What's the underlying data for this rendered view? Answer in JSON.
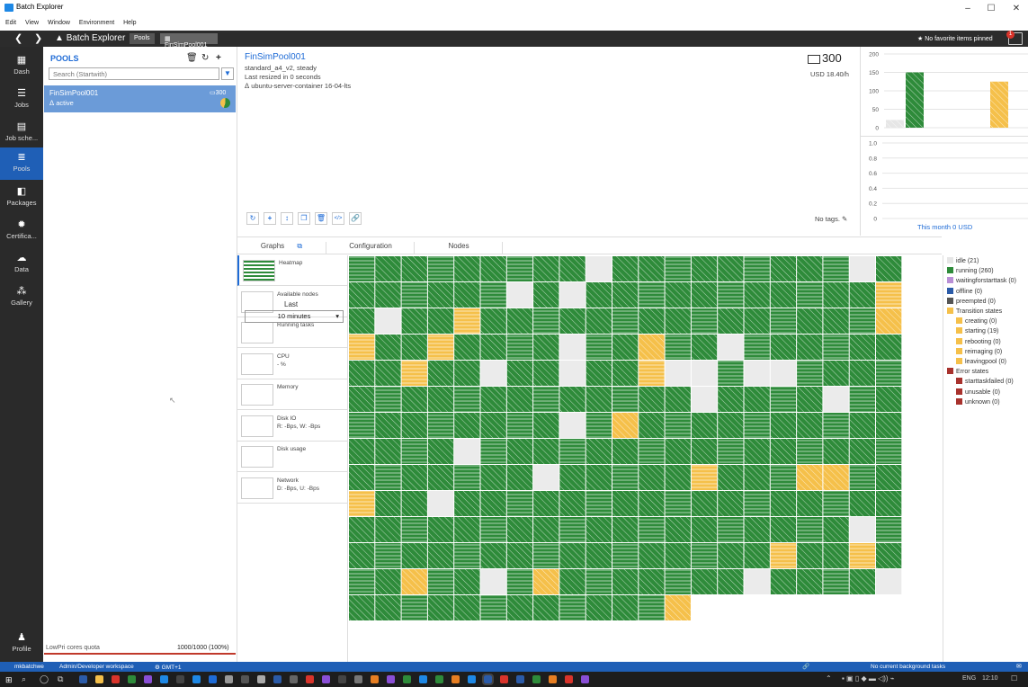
{
  "window": {
    "title": "Batch Explorer",
    "min": "–",
    "max": "☐",
    "close": "✕"
  },
  "menu": [
    "Edit",
    "View",
    "Window",
    "Environment",
    "Help"
  ],
  "nav": {
    "brand": "Batch Explorer",
    "crumbs": [
      "Pools",
      "FinSimPool001"
    ],
    "favorites": "★ No favorite items pinned",
    "badge": "1"
  },
  "sidebar": [
    {
      "label": "Dash",
      "icon": "▦"
    },
    {
      "label": "Jobs",
      "icon": "☰"
    },
    {
      "label": "Job sche...",
      "icon": "▤"
    },
    {
      "label": "Pools",
      "icon": "≣"
    },
    {
      "label": "Packages",
      "icon": "◧"
    },
    {
      "label": "Certifica...",
      "icon": "✹"
    },
    {
      "label": "Data",
      "icon": "☁"
    },
    {
      "label": "Gallery",
      "icon": "⁂"
    },
    {
      "label": "Profile",
      "icon": "♟"
    }
  ],
  "pools_panel": {
    "title": "POOLS",
    "search_placeholder": "Search (Startwith)",
    "item": {
      "name": "FinSimPool001",
      "state": "ⵠ active",
      "count": "300"
    },
    "quota_label": "LowPri cores quota",
    "quota_value": "1000/1000 (100%)"
  },
  "pool": {
    "name": "FinSimPool001",
    "vm": "standard_a4_v2, steady",
    "resized": "Last resized in 0 seconds",
    "os": "ⵠ ubuntu-server-container 16-04-lts",
    "node_count": "300",
    "cost": "USD 18.40/h",
    "no_tags": "No tags. ✎"
  },
  "cost_link": "This month 0 USD",
  "chart_data": [
    {
      "type": "bar",
      "categories": [
        "idle",
        "running",
        "transition"
      ],
      "values": [
        21,
        150,
        125
      ],
      "ylim": [
        0,
        200
      ],
      "yticks": [
        "200",
        "150",
        "100",
        "50",
        "0"
      ],
      "colors": [
        "#e6e6e6",
        "#2e8b3a",
        "#f5c04a"
      ]
    },
    {
      "type": "line",
      "values": [],
      "ylim": [
        0,
        1.0
      ],
      "yticks": [
        "1.0",
        "0.8",
        "0.6",
        "0.4",
        "0.2",
        "0"
      ]
    }
  ],
  "tabs": [
    "Graphs",
    "Configuration",
    "Nodes"
  ],
  "graphs": [
    {
      "label": "Heatmap",
      "sub": ""
    },
    {
      "label": "Available nodes",
      "sub": ""
    },
    {
      "label": "Running tasks",
      "sub": ""
    },
    {
      "label": "CPU",
      "sub": "- %"
    },
    {
      "label": "Memory",
      "sub": ""
    },
    {
      "label": "Disk IO",
      "sub": "R: -Bps, W: -Bps"
    },
    {
      "label": "Disk usage",
      "sub": ""
    },
    {
      "label": "Network",
      "sub": "D: -Bps, U: -Bps"
    }
  ],
  "last_label": "Last",
  "last_value": "10 minutes",
  "heatmap": {
    "rows": [
      "RRRRRRRRRIRRRRRRRRRIR",
      "RRRRRRIRIRRRRRRRRRRRT",
      "RIRRTRRRRRRRRRRRRRRRT",
      "TRRTRRRRIRRTRRIRRRRRR",
      "RRTRRIRRIRRTIIRIIRRRR",
      "RRRRRRRRRRRRRIRRRRIRR",
      "RRRRRRRRIRTRRRRRRRRRR",
      "RRRRIRRRRRRRRRRRRRRRR",
      "RRRRRRRIRRRRRTRRRTTRR",
      "TRRIRRRRRRRRRRRRRRRRR",
      "RRRRRRRRRRRRRRRRRRRIR",
      "RRRRRRRRRRRRRRRRTRRTR",
      "RRTRRIRTRRRRRRRIRRRRI",
      "RRRRRRRRRRRRT"
    ],
    "colors": {
      "R": "#2e8b3a",
      "I": "#ebebeb",
      "T": "#f5c04a"
    }
  },
  "legend": [
    {
      "label": "idle (21)",
      "color": "#e6e6e6",
      "indent": false
    },
    {
      "label": "running (260)",
      "color": "#2e8b3a",
      "indent": false
    },
    {
      "label": "waitingforstarttask (0)",
      "color": "#b98fd6",
      "indent": false
    },
    {
      "label": "offline (0)",
      "color": "#2b5ba8",
      "indent": false
    },
    {
      "label": "preempted (0)",
      "color": "#555555",
      "indent": false
    },
    {
      "label": "Transition states",
      "color": "#f5c04a",
      "indent": false
    },
    {
      "label": "creating (0)",
      "color": "#f5c04a",
      "indent": true
    },
    {
      "label": "starting (19)",
      "color": "#f5c04a",
      "indent": true
    },
    {
      "label": "rebooting (0)",
      "color": "#f5c04a",
      "indent": true
    },
    {
      "label": "reimaging (0)",
      "color": "#f5c04a",
      "indent": true
    },
    {
      "label": "leavingpool (0)",
      "color": "#f5c04a",
      "indent": true
    },
    {
      "label": "Error states",
      "color": "#a8322d",
      "indent": false
    },
    {
      "label": "starttaskfailed (0)",
      "color": "#a8322d",
      "indent": true
    },
    {
      "label": "unusable (0)",
      "color": "#a8322d",
      "indent": true
    },
    {
      "label": "unknown (0)",
      "color": "#a8322d",
      "indent": true
    }
  ],
  "status": {
    "user": "mkbatchwe",
    "workspace": "Admin/Developer workspace",
    "tz": "⚙ GMT+1",
    "bg": "No current background tasks"
  },
  "taskbar": {
    "lang": "ENG",
    "time": "12:10"
  }
}
